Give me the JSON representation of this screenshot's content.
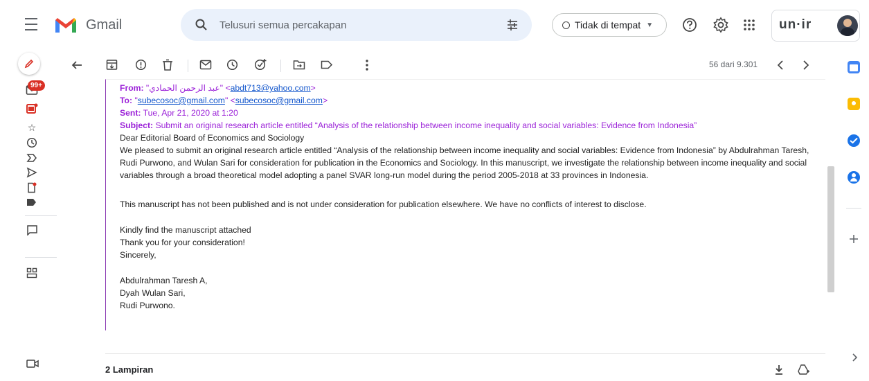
{
  "header": {
    "brand": "Gmail",
    "search_placeholder": "Telusuri semua percakapan",
    "status": "Tidak di tempat",
    "org_logo": "un·ir",
    "colors": {
      "gmail_red": "#ea4335",
      "search_bg": "#eaf1fb"
    }
  },
  "rail": {
    "badge": "99+",
    "icons": [
      "pencil-icon",
      "inbox-icon",
      "snoozed-label-icon",
      "star-icon",
      "clock-icon",
      "important-icon",
      "send-icon",
      "draft-icon",
      "label-icon",
      "chat-icon",
      "spaces-icon",
      "video-icon"
    ]
  },
  "toolbar": {
    "counter": "56 dari 9.301",
    "icons": [
      "back-arrow-icon",
      "archive-icon",
      "report-icon",
      "delete-icon",
      "mail-unread-icon",
      "snooze-icon",
      "add-task-icon",
      "move-to-icon",
      "label-icon",
      "more-vert-icon"
    ]
  },
  "email": {
    "from_label": "From:",
    "from_name": "\"عبد الرحمن الحمادي\" <",
    "from_email": "abdt713@yahoo.com",
    "from_close": ">",
    "to_label": "To:",
    "to_name_quote": "\"",
    "to_name": "subecosoc@gmail.com",
    "to_name_end": "\" <",
    "to_email": "subecosoc@gmail.com",
    "to_close": ">",
    "sent_label": "Sent:",
    "sent_value": " Tue, Apr 21, 2020 at 1:20",
    "subject_label": "Subject:",
    "subject_value": " Submit an original research article entitled “Analysis of the relationship between income inequality and social variables: Evidence from Indonesia”",
    "greeting": "Dear Editorial Board of Economics and Sociology",
    "para1": "We pleased to submit an original research article entitled “Analysis of the relationship between income inequality and social variables: Evidence from Indonesia” by Abdulrahman Taresh, Rudi Purwono, and Wulan Sari for consideration for publication in the Economics and Sociology. In this manuscript, we investigate the relationship between income inequality and social variables through a broad theoretical model adopting a panel SVAR long-run model during the period 2005-2018 at 33 provinces in Indonesia.",
    "para2": "This manuscript has not been published and is not under consideration for publication elsewhere. We have no conflicts of interest to disclose.",
    "closing1": "Kindly find the manuscript attached",
    "closing2": "Thank you for your consideration!",
    "closing3": "Sincerely,",
    "sig1": "Abdulrahman Taresh A,",
    "sig2": "Dyah Wulan Sari,",
    "sig3": "Rudi Purwono."
  },
  "attachments": {
    "label": "2 Lampiran"
  }
}
